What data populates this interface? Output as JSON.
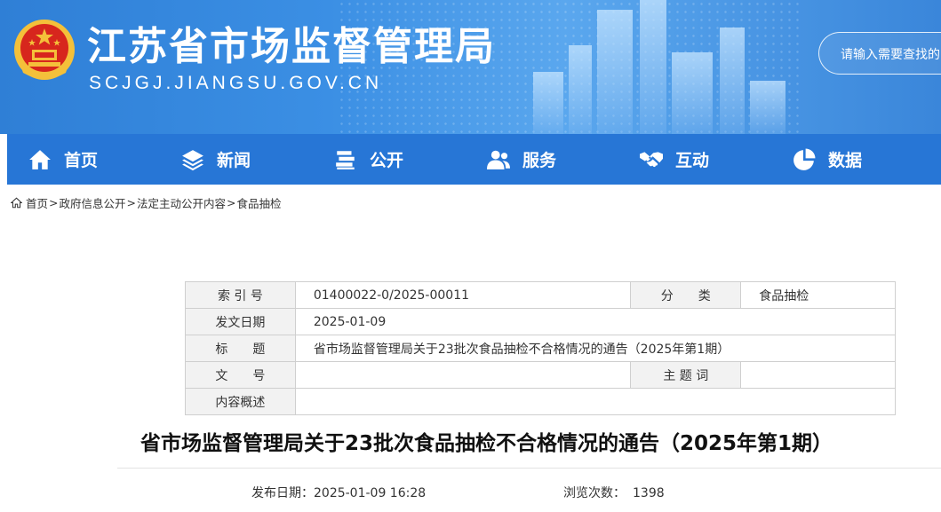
{
  "header": {
    "site_title": "江苏省市场监督管理局",
    "site_domain": "SCJGJ.JIANGSU.GOV.CN",
    "search_placeholder": "请输入需要查找的"
  },
  "nav": {
    "items": [
      {
        "label": "首页",
        "icon": "home-icon"
      },
      {
        "label": "新闻",
        "icon": "layers-icon"
      },
      {
        "label": "公开",
        "icon": "books-icon"
      },
      {
        "label": "服务",
        "icon": "users-icon"
      },
      {
        "label": "互动",
        "icon": "handshake-icon"
      },
      {
        "label": "数据",
        "icon": "pie-chart-icon"
      }
    ]
  },
  "breadcrumb": {
    "icon": "home-icon",
    "items": [
      "首页",
      "政府信息公开",
      "法定主动公开内容",
      "食品抽检"
    ],
    "separator": ">"
  },
  "info": {
    "index_label": "索 引 号",
    "index_value": "01400022-0/2025-00011",
    "category_label": "分　　类",
    "category_value": "食品抽检",
    "date_label": "发文日期",
    "date_value": "2025-01-09",
    "title_label": "标　　题",
    "title_value": "省市场监督管理局关于23批次食品抽检不合格情况的通告（2025年第1期）",
    "doc_no_label": "文　　号",
    "doc_no_value": "",
    "keyword_label": "主 题 词",
    "keyword_value": "",
    "summary_label": "内容概述",
    "summary_value": ""
  },
  "article": {
    "title": "省市场监督管理局关于23批次食品抽检不合格情况的通告（2025年第1期）",
    "publish_label": "发布日期：",
    "publish_value": "2025-01-09 16:28",
    "views_label": "浏览次数：",
    "views_value": "1398"
  }
}
